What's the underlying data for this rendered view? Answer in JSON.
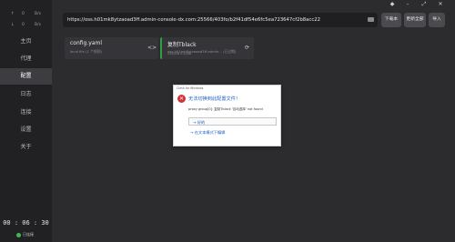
{
  "window_controls": {
    "pin": "◆",
    "minimize": "–",
    "maximize": "⤢",
    "close": "✕"
  },
  "sidebar": {
    "up": {
      "arrow": "↑",
      "value": "0",
      "unit": "B/s"
    },
    "down": {
      "arrow": "↓",
      "value": "0",
      "unit": "B/s"
    },
    "items": [
      {
        "label": "主页"
      },
      {
        "label": "代理"
      },
      {
        "label": "配置"
      },
      {
        "label": "日志"
      },
      {
        "label": "连接"
      },
      {
        "label": "设置"
      },
      {
        "label": "关于"
      }
    ],
    "active_index": 2,
    "clock": "00 : 06 : 30",
    "status": "已连接"
  },
  "toolbar": {
    "url": "https://oss.h01mk8ytzaoad3ff.admin-console-dx.com:25566/403fo/b2f41df54e6fc5ea723647cf2b8acc22",
    "download_label": "下载本",
    "update_all_label": "更新全部",
    "import_label": "导入"
  },
  "profiles": [
    {
      "name": "config.yaml",
      "sub": "local file (1 个规则)",
      "action_icon": "<>"
    },
    {
      "name": "复制Tblack",
      "sub": "oss.h01mk8ytzaoad3ff.admin... (已过期)",
      "traffic": "295/GB 0.5/GB",
      "action_icon": "⟳"
    }
  ],
  "dialog": {
    "title": "Clash for Windows",
    "heading": "无法切换到此配置文件！",
    "body": "proxy group[0]: 复制Tblack '自动选择' not found",
    "option_ok": "→ 好的",
    "option_text": "→ 在文本模式下编辑"
  }
}
